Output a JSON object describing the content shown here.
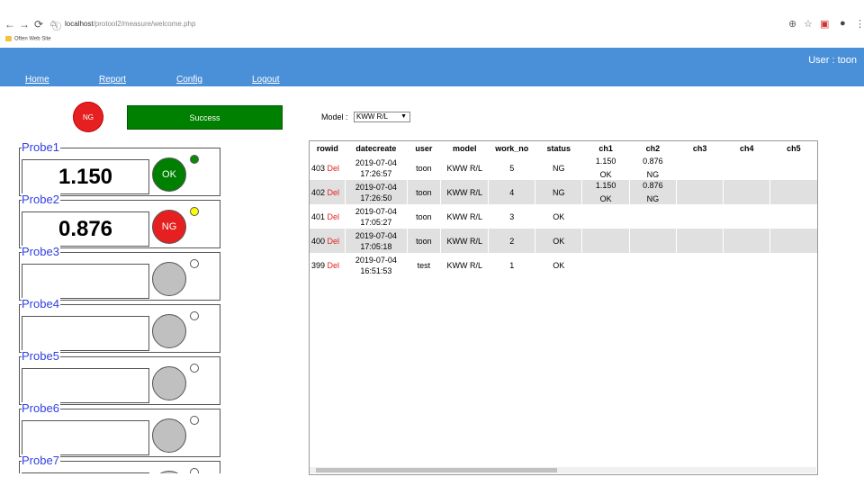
{
  "browser": {
    "url_host": "localhost",
    "url_path": "/protool2/measure/welcome.php",
    "bookmark": "Often Web Site"
  },
  "header": {
    "user": "User : toon",
    "menu": [
      "Home",
      "Report",
      "Config",
      "Logout"
    ]
  },
  "status": {
    "overall": "NG",
    "message": "Success"
  },
  "model": {
    "label": "Model :",
    "selected": "KWW R/L"
  },
  "colors": {
    "header_blue": "#4a90d9",
    "ok_green": "#008000",
    "ng_red": "#e62020",
    "probe_title_blue": "#3040e0"
  },
  "probes": [
    {
      "name": "Probe1",
      "value": "1.150",
      "status": "OK",
      "indicator": "green"
    },
    {
      "name": "Probe2",
      "value": "0.876",
      "status": "NG",
      "indicator": "yellow"
    },
    {
      "name": "Probe3",
      "value": "",
      "status": "",
      "indicator": "none"
    },
    {
      "name": "Probe4",
      "value": "",
      "status": "",
      "indicator": "none"
    },
    {
      "name": "Probe5",
      "value": "",
      "status": "",
      "indicator": "none"
    },
    {
      "name": "Probe6",
      "value": "",
      "status": "",
      "indicator": "none"
    },
    {
      "name": "Probe7",
      "value": "",
      "status": "",
      "indicator": "none"
    }
  ],
  "table": {
    "columns": [
      "rowid",
      "datecreate",
      "user",
      "model",
      "work_no",
      "status",
      "ch1",
      "ch2",
      "ch3",
      "ch4",
      "ch5"
    ],
    "del_label": "Del",
    "rows": [
      {
        "rowid": "403",
        "date": "2019-07-04",
        "time": "17:26:57",
        "user": "toon",
        "model": "KWW R/L",
        "work_no": "5",
        "status": "NG",
        "ch1": "1.150",
        "ch1_status": "OK",
        "ch2": "0.876",
        "ch2_status": "NG"
      },
      {
        "rowid": "402",
        "date": "2019-07-04",
        "time": "17:26:50",
        "user": "toon",
        "model": "KWW R/L",
        "work_no": "4",
        "status": "NG",
        "ch1": "1.150",
        "ch1_status": "OK",
        "ch2": "0.876",
        "ch2_status": "NG"
      },
      {
        "rowid": "401",
        "date": "2019-07-04",
        "time": "17:05:27",
        "user": "toon",
        "model": "KWW R/L",
        "work_no": "3",
        "status": "OK",
        "ch1": "",
        "ch1_status": "",
        "ch2": "",
        "ch2_status": ""
      },
      {
        "rowid": "400",
        "date": "2019-07-04",
        "time": "17:05:18",
        "user": "toon",
        "model": "KWW R/L",
        "work_no": "2",
        "status": "OK",
        "ch1": "",
        "ch1_status": "",
        "ch2": "",
        "ch2_status": ""
      },
      {
        "rowid": "399",
        "date": "2019-07-04",
        "time": "16:51:53",
        "user": "test",
        "model": "KWW R/L",
        "work_no": "1",
        "status": "OK",
        "ch1": "",
        "ch1_status": "",
        "ch2": "",
        "ch2_status": ""
      }
    ]
  }
}
